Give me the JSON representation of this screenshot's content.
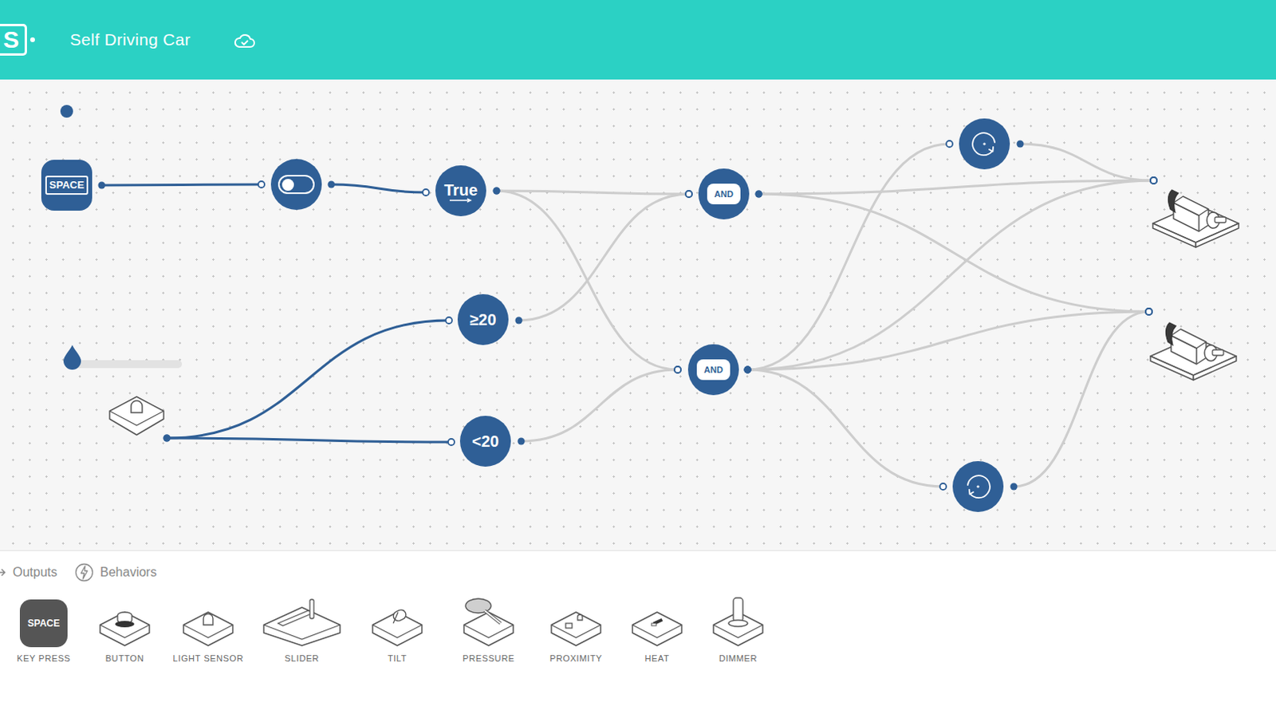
{
  "app": {
    "logo": "S",
    "title": "Self Driving Car",
    "saved": true
  },
  "nodes": [
    {
      "kind": "key",
      "label": "SPACE",
      "indicator": true
    },
    {
      "kind": "toggle",
      "on": false
    },
    {
      "kind": "value",
      "label": "True"
    },
    {
      "kind": "compare",
      "label": "≥20"
    },
    {
      "kind": "compare",
      "label": "<20"
    },
    {
      "kind": "logic",
      "label": "AND"
    },
    {
      "kind": "logic",
      "label": "AND"
    },
    {
      "kind": "rotate",
      "direction": "cw"
    },
    {
      "kind": "rotate",
      "direction": "ccw"
    },
    {
      "kind": "motor"
    },
    {
      "kind": "motor"
    },
    {
      "kind": "light-sensor"
    },
    {
      "kind": "slider",
      "level": 0
    }
  ],
  "wires": [
    {
      "active": true
    },
    {
      "active": true
    },
    {
      "active": true
    },
    {
      "active": true
    },
    {
      "active": false
    },
    {
      "active": false
    },
    {
      "active": false
    },
    {
      "active": false
    },
    {
      "active": false
    },
    {
      "active": false
    },
    {
      "active": false
    },
    {
      "active": false
    },
    {
      "active": false
    },
    {
      "active": false
    },
    {
      "active": false
    },
    {
      "active": false
    }
  ],
  "palette": {
    "tabs": [
      {
        "label": "Outputs",
        "selected": false
      },
      {
        "label": "Behaviors",
        "selected": false
      }
    ],
    "items": [
      {
        "kind": "key",
        "label": "KEY PRESS",
        "key": "SPACE"
      },
      {
        "kind": "button",
        "label": "BUTTON"
      },
      {
        "kind": "light",
        "label": "LIGHT SENSOR"
      },
      {
        "kind": "slider",
        "label": "SLIDER"
      },
      {
        "kind": "tilt",
        "label": "TILT"
      },
      {
        "kind": "pressure",
        "label": "PRESSURE"
      },
      {
        "kind": "proximity",
        "label": "PROXIMITY"
      },
      {
        "kind": "heat",
        "label": "HEAT"
      },
      {
        "kind": "dimmer",
        "label": "DIMMER"
      }
    ]
  }
}
